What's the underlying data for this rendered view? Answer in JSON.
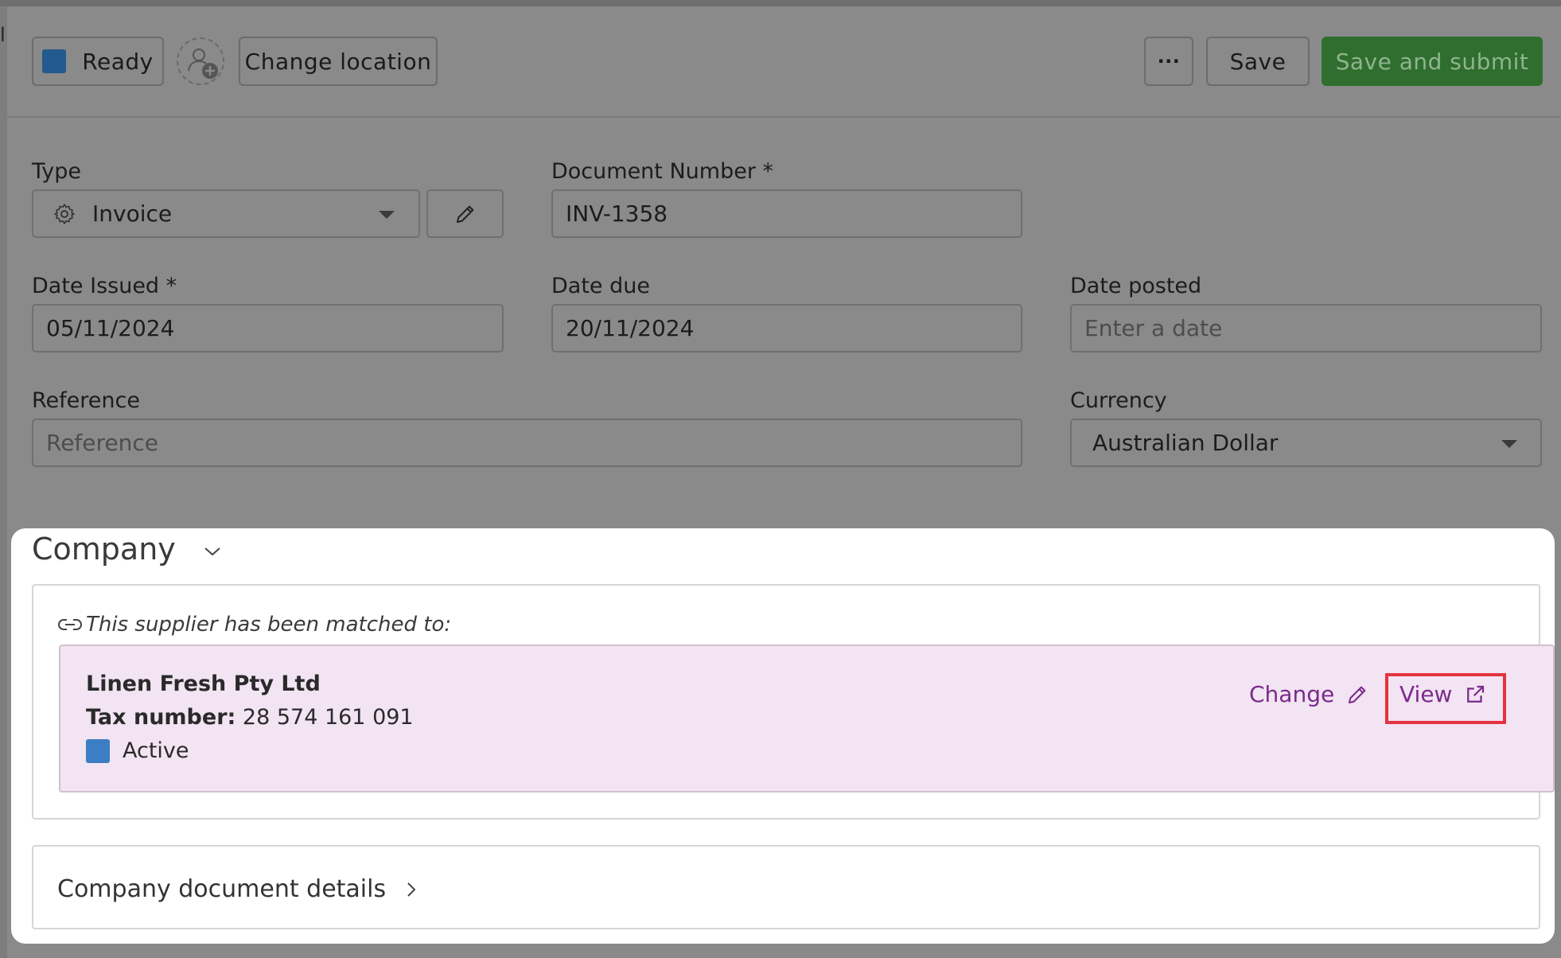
{
  "toolbar": {
    "status_label": "Ready",
    "change_location_label": "Change location",
    "more_label": "···",
    "save_label": "Save",
    "save_submit_label": "Save and submit"
  },
  "form": {
    "type_label": "Type",
    "type_value": "Invoice",
    "doc_number_label": "Document Number *",
    "doc_number_value": "INV-1358",
    "date_issued_label": "Date Issued *",
    "date_issued_value": "05/11/2024",
    "date_due_label": "Date due",
    "date_due_value": "20/11/2024",
    "date_posted_label": "Date posted",
    "date_posted_placeholder": "Enter a date",
    "reference_label": "Reference",
    "reference_placeholder": "Reference",
    "currency_label": "Currency",
    "currency_value": "Australian Dollar"
  },
  "company": {
    "title": "Company",
    "matched_text": "This supplier has been matched to:",
    "supplier_name": "Linen Fresh Pty Ltd",
    "tax_label": "Tax number:",
    "tax_value": " 28 574 161 091",
    "status": "Active",
    "change_label": "Change",
    "view_label": "View",
    "details_label": "Company document details"
  },
  "colors": {
    "primary_button": "#2f6e2e",
    "status_ready": "#235a8f",
    "status_active": "#3b7ec4",
    "link": "#7b2a8c",
    "highlight_box": "#e4333f"
  }
}
